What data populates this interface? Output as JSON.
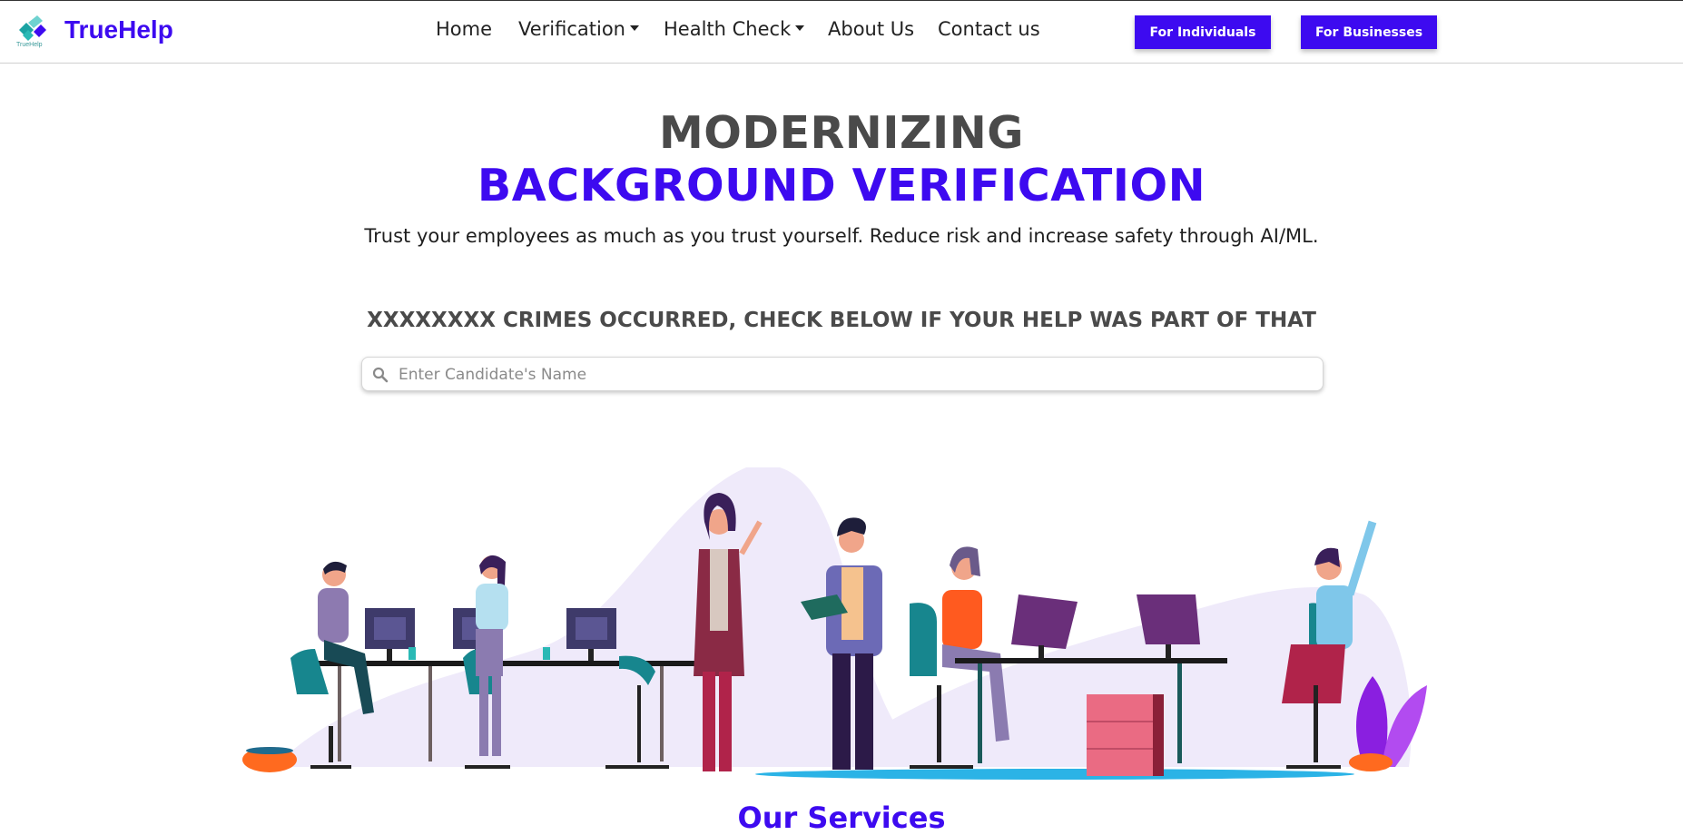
{
  "brand": {
    "name": "TrueHelp",
    "logo_small_text": "TrueHelp",
    "logo_icon": "truehelp-logo-icon"
  },
  "nav": {
    "items": [
      {
        "label": "Home",
        "has_dropdown": false
      },
      {
        "label": "Verification",
        "has_dropdown": true
      },
      {
        "label": "Health Check",
        "has_dropdown": true
      },
      {
        "label": "About Us",
        "has_dropdown": false
      },
      {
        "label": "Contact us",
        "has_dropdown": false
      }
    ],
    "buttons": {
      "individuals": "For Individuals",
      "businesses": "For Businesses"
    }
  },
  "hero": {
    "title_line1": "MODERNIZING",
    "title_line2": "BACKGROUND VERIFICATION",
    "subtitle": "Trust your employees as much as you trust yourself. Reduce risk and increase safety through AI/ML."
  },
  "search": {
    "heading": "XXXXXXXX CRIMES OCCURRED, CHECK BELOW IF YOUR HELP WAS PART OF THAT",
    "placeholder": "Enter Candidate's Name",
    "value": "",
    "icon": "search-icon"
  },
  "illustration": {
    "icon": "office-team-illustration"
  },
  "services": {
    "heading": "Our Services"
  },
  "colors": {
    "primary": "#3d0af0",
    "heading_gray": "#4a4a4a",
    "text": "#1f1f1f",
    "teal": "#1aa3a3",
    "lavender": "#efeafa"
  }
}
